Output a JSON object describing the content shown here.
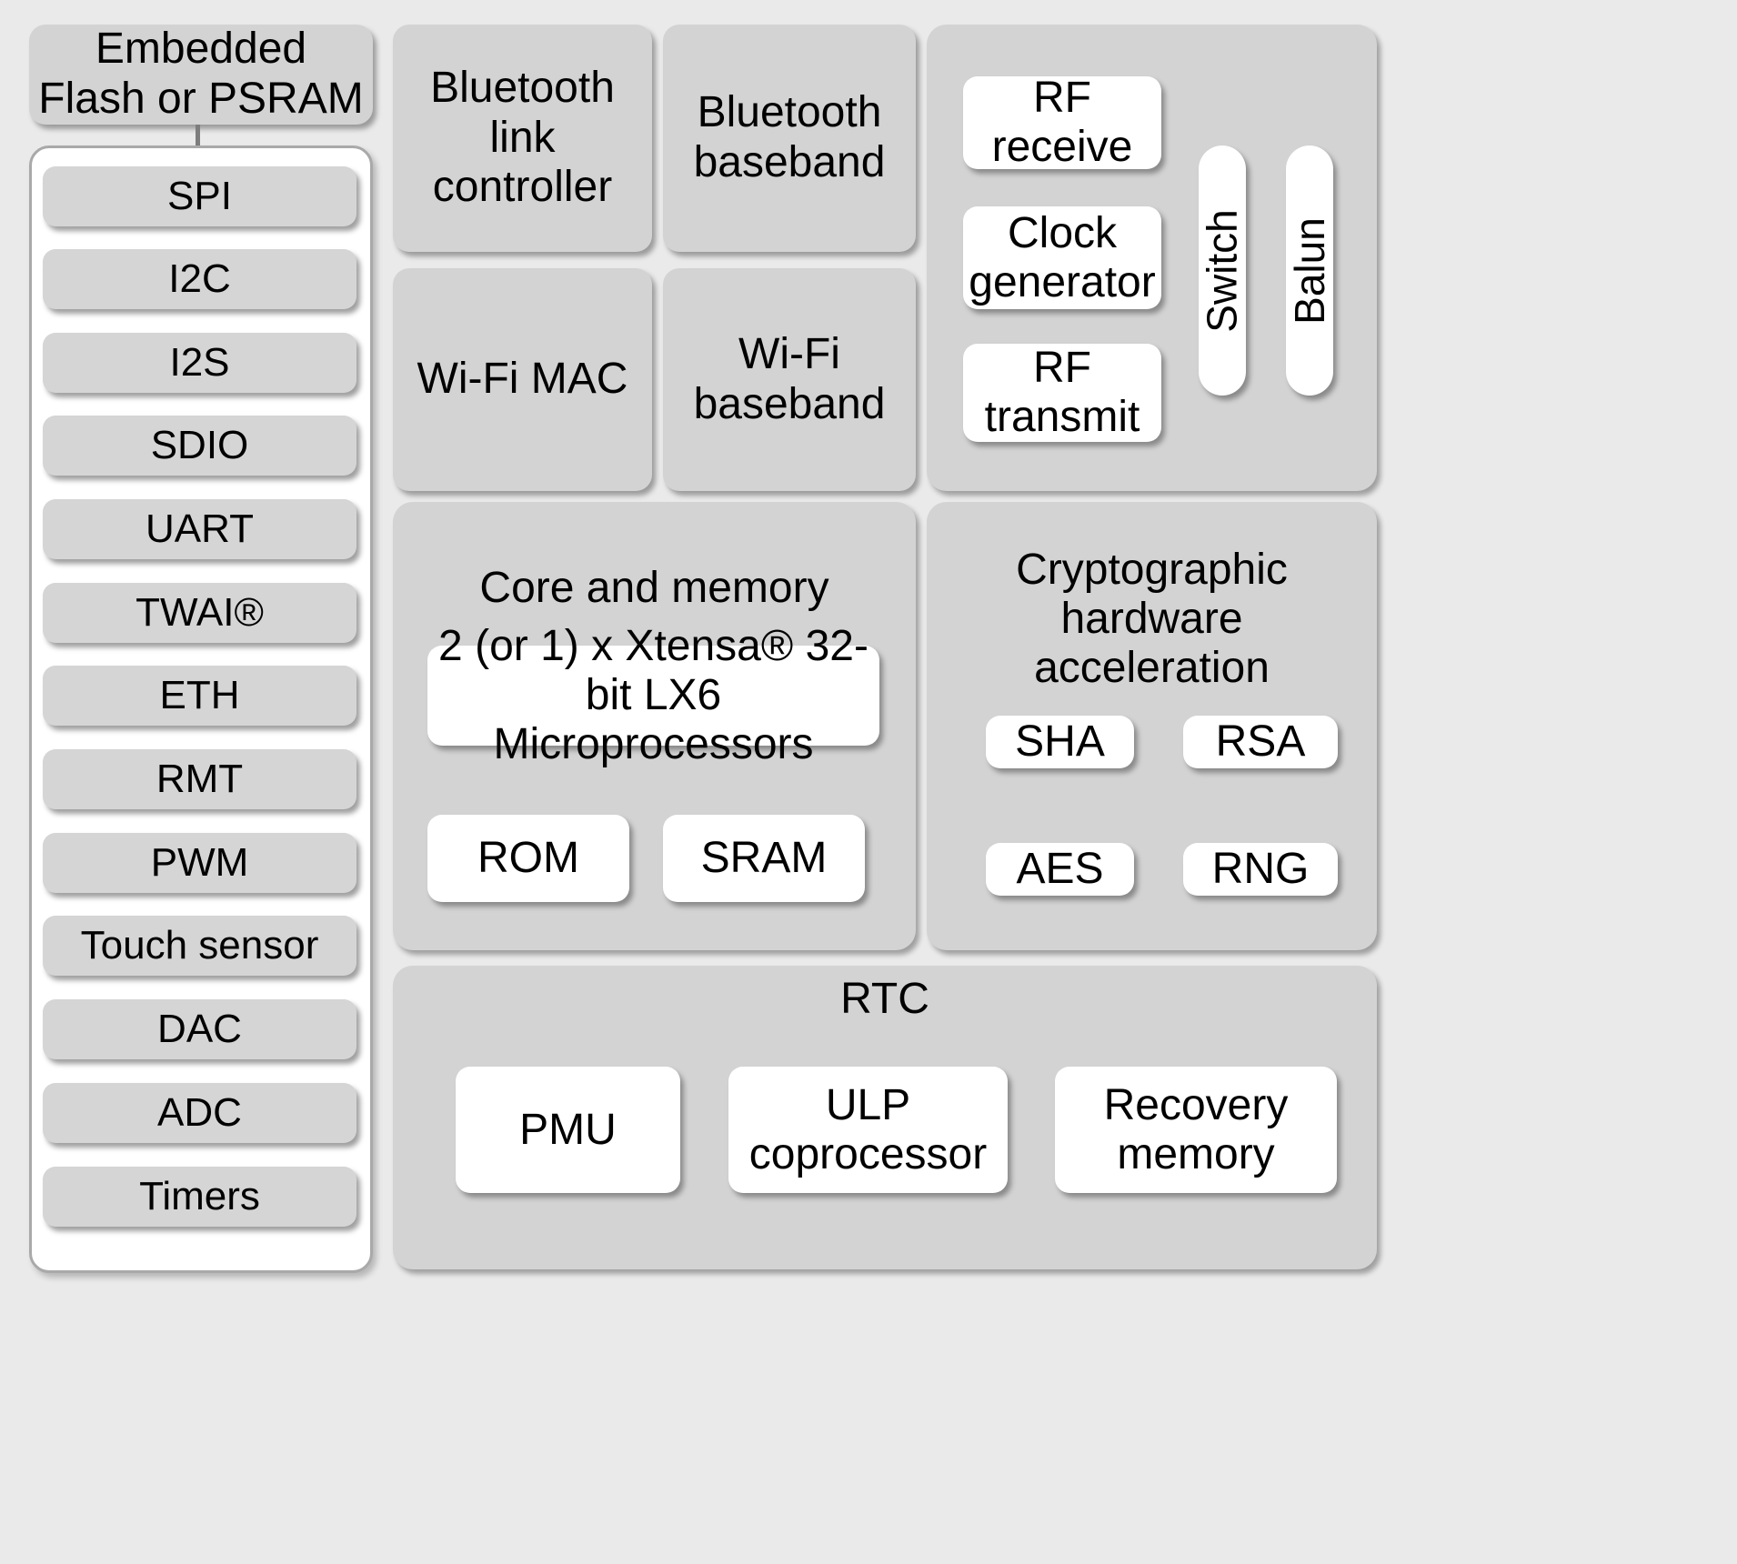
{
  "diagram": {
    "title": "ESP32 functional block diagram",
    "colors": {
      "background": "#eaeaea",
      "panel_gray": "#d3d3d3",
      "pill_gray": "#d5d5d5",
      "box_white": "#ffffff",
      "border_gray": "#a9a9a9",
      "connector": "#7d7d7d",
      "text": "#000000"
    }
  },
  "external_memory": {
    "label": "Embedded\nFlash or PSRAM",
    "line1": "Embedded",
    "line2": "Flash or PSRAM"
  },
  "peripherals": {
    "items": [
      {
        "label": "SPI"
      },
      {
        "label": "I2C"
      },
      {
        "label": "I2S"
      },
      {
        "label": "SDIO"
      },
      {
        "label": "UART"
      },
      {
        "label": "TWAI®"
      },
      {
        "label": "ETH"
      },
      {
        "label": "RMT"
      },
      {
        "label": "PWM"
      },
      {
        "label": "Touch sensor"
      },
      {
        "label": "DAC"
      },
      {
        "label": "ADC"
      },
      {
        "label": "Timers"
      }
    ]
  },
  "radio_blocks": {
    "bluetooth_link_controller": {
      "line1": "Bluetooth",
      "line2": "link",
      "line3": "controller"
    },
    "bluetooth_baseband": {
      "line1": "Bluetooth",
      "line2": "baseband"
    },
    "wifi_mac": {
      "label": "Wi-Fi MAC"
    },
    "wifi_baseband": {
      "line1": "Wi-Fi",
      "line2": "baseband"
    }
  },
  "rf": {
    "rf_receive": {
      "line1": "RF",
      "line2": "receive"
    },
    "clock_generator": {
      "line1": "Clock",
      "line2": "generator"
    },
    "rf_transmit": {
      "line1": "RF",
      "line2": "transmit"
    },
    "switch": {
      "label": "Switch"
    },
    "balun": {
      "label": "Balun"
    }
  },
  "core_memory": {
    "title": "Core and memory",
    "cpu": {
      "line1": "2 (or 1) x Xtensa® 32-",
      "line2": "bit LX6 Microprocessors"
    },
    "rom": {
      "label": "ROM"
    },
    "sram": {
      "label": "SRAM"
    }
  },
  "crypto": {
    "title_line1": "Cryptographic hardware",
    "title_line2": "acceleration",
    "blocks": [
      {
        "label": "SHA"
      },
      {
        "label": "RSA"
      },
      {
        "label": "AES"
      },
      {
        "label": "RNG"
      }
    ]
  },
  "rtc": {
    "title": "RTC",
    "pmu": {
      "label": "PMU"
    },
    "ulp": {
      "line1": "ULP",
      "line2": "coprocessor"
    },
    "recovery": {
      "line1": "Recovery",
      "line2": "memory"
    }
  }
}
